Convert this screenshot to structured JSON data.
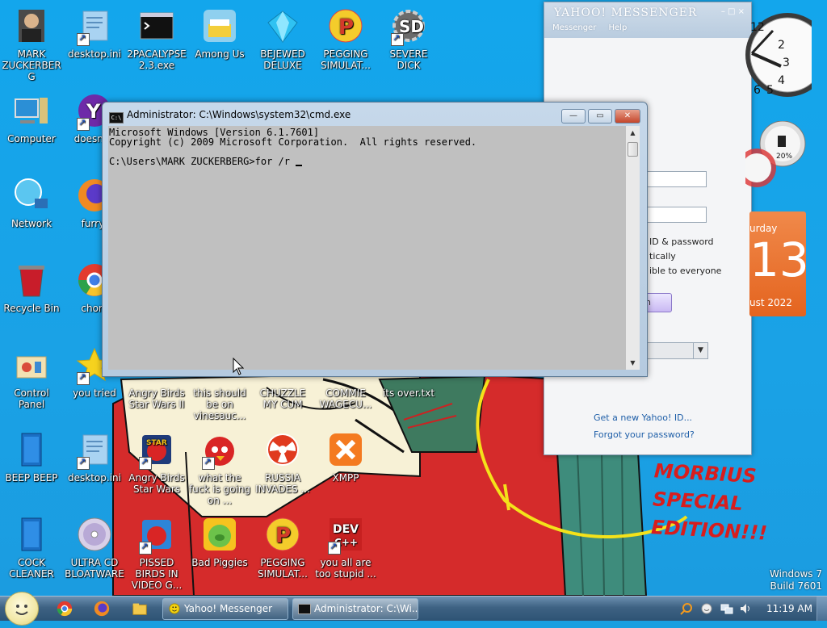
{
  "desktop_icons": [
    {
      "label": "MARK ZUCKERBERG"
    },
    {
      "label": "desktop.ini"
    },
    {
      "label": "2PACALYPSE 2.3.exe"
    },
    {
      "label": "Among Us"
    },
    {
      "label": "BEJEWED DELUXE"
    },
    {
      "label": "PEGGING SIMULAT..."
    },
    {
      "label": "SEVERE DICK"
    },
    {
      "label": "Computer"
    },
    {
      "label": "doesntw"
    },
    {
      "label": "Network"
    },
    {
      "label": "furryf"
    },
    {
      "label": "Recycle Bin"
    },
    {
      "label": "chom"
    },
    {
      "label": "Control Panel"
    },
    {
      "label": "you tried"
    },
    {
      "label": "Angry Birds Star Wars II"
    },
    {
      "label": "this should be on vinesauc..."
    },
    {
      "label": "CHUZZLE MY CUM"
    },
    {
      "label": "COMMIE WAGECU..."
    },
    {
      "label": "its over.txt"
    },
    {
      "label": "BEEP BEEP"
    },
    {
      "label": "desktop.ini"
    },
    {
      "label": "Angry Birds Star Wars"
    },
    {
      "label": "what the fuck is going on ..."
    },
    {
      "label": "RUSSIA INVADES ..."
    },
    {
      "label": "XMPP"
    },
    {
      "label": "COCK CLEANER"
    },
    {
      "label": "ULTRA CD BLOATWARE"
    },
    {
      "label": "PISSED BIRDS IN VIDEO G..."
    },
    {
      "label": "Bad Piggies"
    },
    {
      "label": "PEGGING SIMULAT..."
    },
    {
      "label": "you all are too stupid ..."
    }
  ],
  "cmd_window": {
    "title": "Administrator: C:\\Windows\\system32\\cmd.exe",
    "icon_text": "C:\\",
    "line1": "Microsoft Windows [Version 6.1.7601]",
    "line2": "Copyright (c) 2009 Microsoft Corporation.  All rights reserved.",
    "line3": "",
    "prompt": "C:\\Users\\MARK ZUCKERBERG>for /r ",
    "minimize": "—",
    "maximize": "▭",
    "close": "✕"
  },
  "yahoo_window": {
    "logo": "YAHOO! MESSENGER",
    "menu_messenger": "Messenger",
    "menu_help": "Help",
    "controls": "– □ ×",
    "remember": "ID & password",
    "auto": "tically",
    "invisible": "ible to everyone",
    "signin": "n",
    "get_id": "Get a new Yahoo! ID...",
    "forgot": "Forgot your password?"
  },
  "calendar": {
    "day": "urday",
    "date": "13",
    "month": "ust 2022"
  },
  "cpu_gadget": {
    "percent": "20%"
  },
  "wallpaper_text": {
    "line1": "MORBIUS",
    "line2": "SPECIAL",
    "line3": "EDITION!!!"
  },
  "windows_version": {
    "line1": "Windows 7",
    "line2": "Build 7601"
  },
  "taskbar": {
    "tasks": [
      {
        "label": "Yahoo! Messenger"
      },
      {
        "label": "Administrator: C:\\Wi..."
      }
    ],
    "time": "11:19 AM"
  },
  "colors": {
    "desktop": "#1aa2e6",
    "console_bg": "#c0c0c0",
    "calendar": "#e4641f",
    "morbius_text": "#d81d1d"
  }
}
